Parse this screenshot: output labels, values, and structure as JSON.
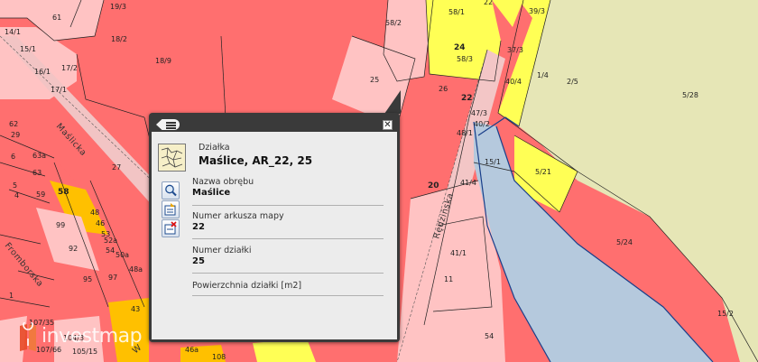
{
  "map": {
    "street_names": [
      "Maślicka",
      "Fromborska",
      "Rędzińska",
      "W"
    ],
    "parcel_labels": {
      "top": [
        "61",
        "19/3",
        "18/2",
        "18/9",
        "14/1",
        "15/1",
        "16/1",
        "17/1",
        "17/2",
        "58/2",
        "58/1",
        "22",
        "24",
        "58/3",
        "25",
        "26",
        "22",
        "37/3",
        "39/3",
        "40/4",
        "40/2",
        "1/4",
        "2/5",
        "5/28"
      ],
      "middle": [
        "62",
        "29",
        "6",
        "5",
        "4",
        "63a",
        "63",
        "27",
        "59",
        "58",
        "99",
        "92",
        "95",
        "48",
        "46",
        "53",
        "52a",
        "54",
        "50a",
        "48a",
        "97",
        "15/1",
        "5/21",
        "41/4",
        "47/3",
        "48/1",
        "20",
        "11",
        "5/24",
        "43",
        "54",
        "15/2",
        "41/1"
      ],
      "bottom": [
        "1",
        "107/35",
        "107/66",
        "104/3",
        "105/15",
        "26a",
        "46a",
        "108"
      ]
    },
    "colors": {
      "red_parcel": "#ff6f6f",
      "pink_parcel": "#ffc3c3",
      "yellow_parcel": "#ffff55",
      "orange_parcel": "#ffc000",
      "green_area": "#e6e6b6",
      "water": "#b5c9dd"
    }
  },
  "popup": {
    "layer_name": "Działka",
    "title": "Maślice, AR_22, 25",
    "icons": [
      "parcel-thumbnail-icon",
      "zoom-to-icon",
      "export-icon",
      "remove-icon",
      "menu-icon",
      "close-icon"
    ],
    "close_label": "✕",
    "fields": [
      {
        "label": "Nazwa obrębu",
        "value": "Maślice"
      },
      {
        "label": "Numer arkusza mapy",
        "value": "22"
      },
      {
        "label": "Numer działki",
        "value": "25"
      },
      {
        "label": "Powierzchnia działki [m2]",
        "value": ""
      }
    ]
  },
  "watermark": {
    "text": "investmap"
  }
}
